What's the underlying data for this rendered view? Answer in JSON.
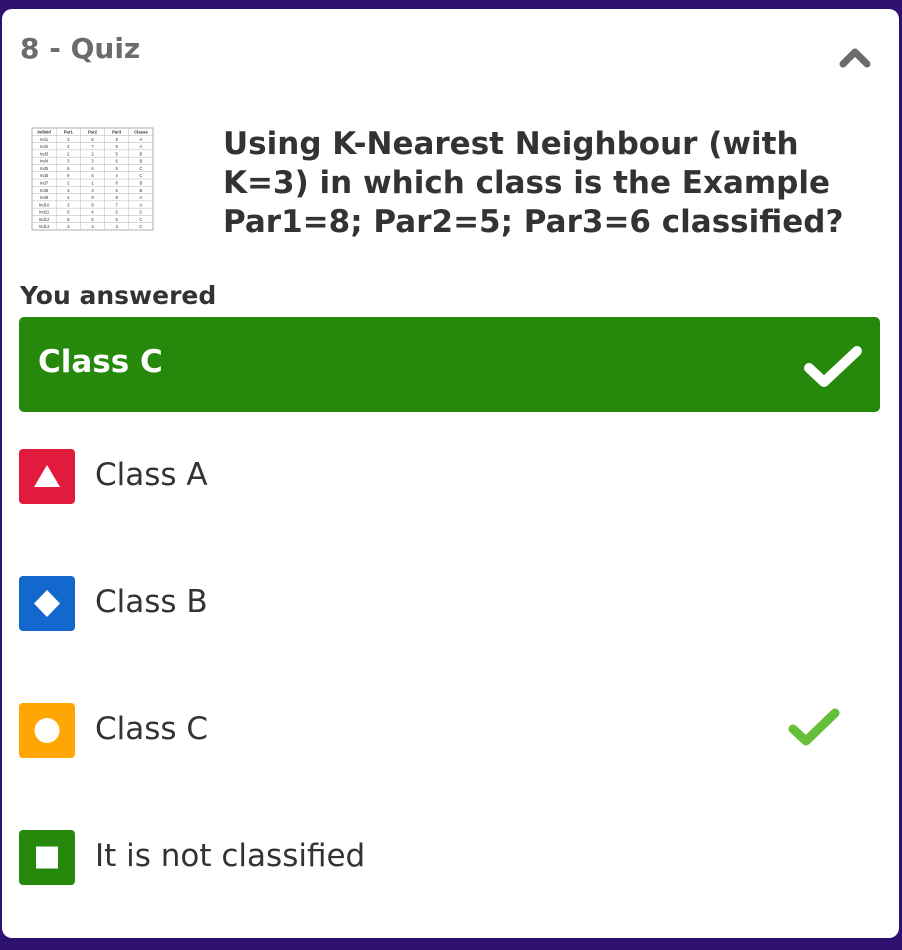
{
  "quiz": {
    "title": "8 - Quiz"
  },
  "question": {
    "text": "Using K-Nearest Neighbour (with K=3) in which class is the Example Par1=8; Par2=5; Par3=6 classified?",
    "table": {
      "headers": [
        "Individ",
        "Par1",
        "Par2",
        "Par3",
        "Classe"
      ],
      "rows": [
        [
          "Ind1",
          "3",
          "8",
          "9",
          "A"
        ],
        [
          "Ind2",
          "4",
          "7",
          "8",
          "A"
        ],
        [
          "Ind3",
          "2",
          "2",
          "5",
          "B"
        ],
        [
          "Ind4",
          "3",
          "3",
          "6",
          "B"
        ],
        [
          "Ind5",
          "8",
          "6",
          "5",
          "C"
        ],
        [
          "Ind6",
          "9",
          "5",
          "4",
          "C"
        ],
        [
          "Ind7",
          "2",
          "1",
          "6",
          "B"
        ],
        [
          "Ind8",
          "3",
          "3",
          "5",
          "B"
        ],
        [
          "Ind9",
          "4",
          "9",
          "8",
          "A"
        ],
        [
          "Ind10",
          "3",
          "8",
          "7",
          "A"
        ],
        [
          "Ind11",
          "0",
          "4",
          "6",
          "C"
        ],
        [
          "Ind12",
          "8",
          "5",
          "5",
          "C"
        ],
        [
          "Ind13",
          "3",
          "3",
          "3",
          "C"
        ]
      ]
    }
  },
  "answered": {
    "label": "You answered",
    "answer": "Class C",
    "correct": true
  },
  "options": [
    {
      "label": "Class A",
      "shape": "triangle-icon",
      "color": "#e21b3c",
      "correct": false
    },
    {
      "label": "Class B",
      "shape": "diamond-icon",
      "color": "#1368ce",
      "correct": false
    },
    {
      "label": "Class C",
      "shape": "circle-icon",
      "color": "#ffa602",
      "correct": true
    },
    {
      "label": "It is not classified",
      "shape": "square-icon",
      "color": "#26890c",
      "correct": false
    }
  ],
  "colors": {
    "correct_green": "#26890c",
    "check_green": "#66bf39",
    "background": "#2e1070"
  }
}
